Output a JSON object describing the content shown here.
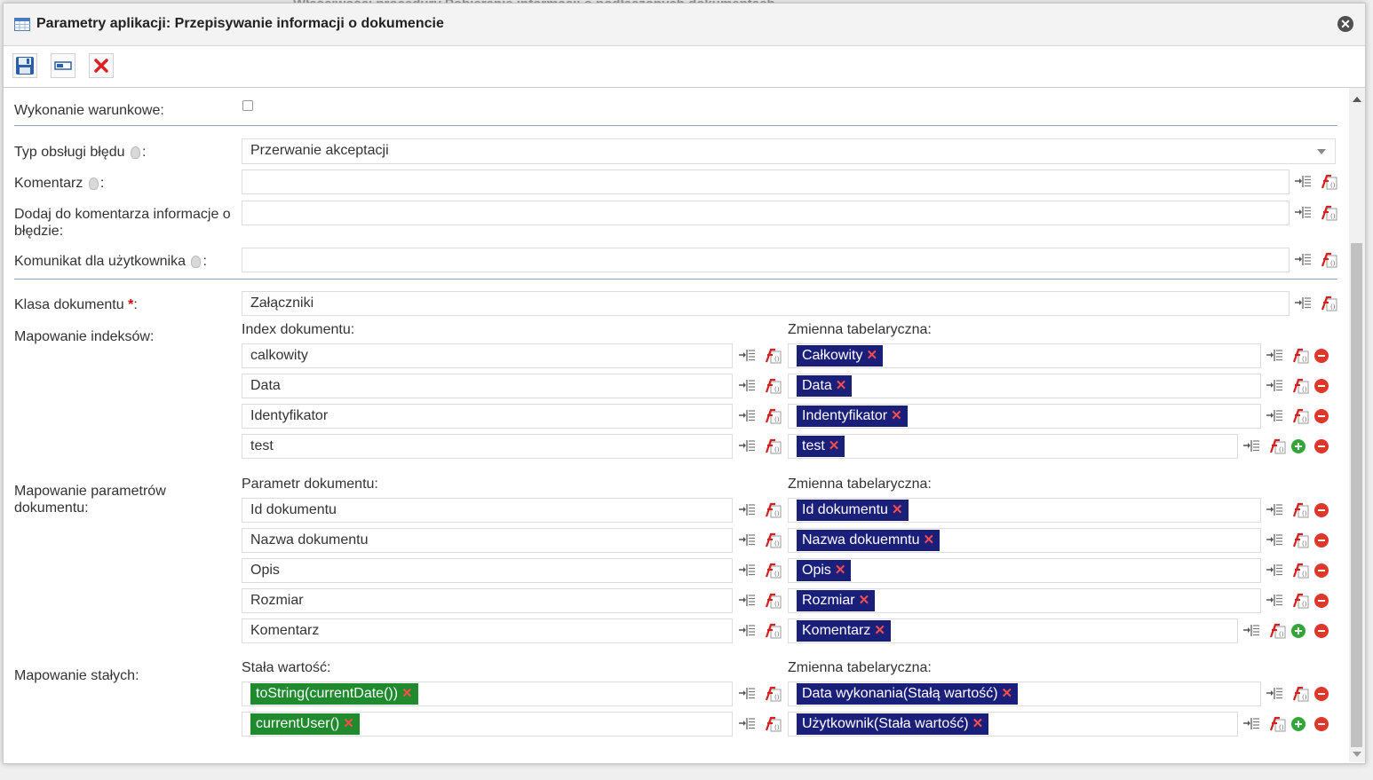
{
  "background": {
    "title": "Właściwości procedury Pobieranie informacji o podłączonych dokumentach"
  },
  "dialog": {
    "title": "Parametry aplikacji: Przepisywanie informacji o dokumencie"
  },
  "toolbar": {
    "save": "save",
    "rename": "rename",
    "delete": "delete"
  },
  "form": {
    "conditional_label": "Wykonanie warunkowe:",
    "error_type_label": "Typ obsługi błędu",
    "error_type_value": "Przerwanie akceptacji",
    "comment_label": "Komentarz",
    "add_comment_label_1": "Dodaj do komentarza informacje o",
    "add_comment_label_2": "błędzie:",
    "user_message_label": "Komunikat dla użytkownika",
    "doc_class_label": "Klasa dokumentu",
    "doc_class_value": "Załączniki",
    "colon": ":",
    "required": "*"
  },
  "index_mapping": {
    "label": "Mapowanie indeksów:",
    "left_header": "Index dokumentu:",
    "right_header": "Zmienna tabelaryczna:",
    "rows": [
      {
        "left": "calkowity",
        "right": "Całkowity"
      },
      {
        "left": "Data",
        "right": "Data"
      },
      {
        "left": "Identyfikator",
        "right": "Indentyfikator"
      },
      {
        "left": "test",
        "right": "test"
      }
    ]
  },
  "param_mapping": {
    "label_1": "Mapowanie parametrów",
    "label_2": "dokumentu:",
    "left_header": "Parametr dokumentu:",
    "right_header": "Zmienna tabelaryczna:",
    "rows": [
      {
        "left": "Id dokumentu",
        "right": "Id dokumentu"
      },
      {
        "left": "Nazwa dokumentu",
        "right": "Nazwa dokuemntu"
      },
      {
        "left": "Opis",
        "right": "Opis"
      },
      {
        "left": "Rozmiar",
        "right": "Rozmiar"
      },
      {
        "left": "Komentarz",
        "right": "Komentarz"
      }
    ]
  },
  "const_mapping": {
    "label": "Mapowanie stałych:",
    "left_header": "Stała wartość:",
    "right_header": "Zmienna tabelaryczna:",
    "rows": [
      {
        "left": "toString(currentDate())",
        "right": "Data wykonania(Stałą wartość)"
      },
      {
        "left": "currentUser()",
        "right": "Użytkownik(Stała wartość)"
      }
    ]
  },
  "tag_remove": "✕"
}
